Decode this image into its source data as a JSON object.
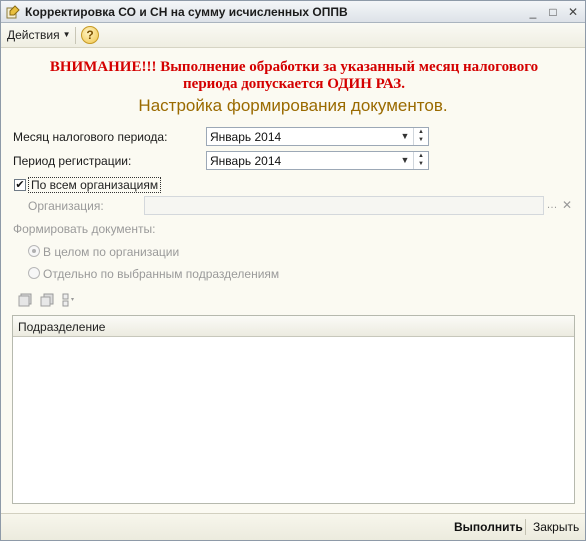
{
  "window": {
    "title": "Корректировка СО и СН на сумму исчисленных ОППВ",
    "icon": "processing-icon"
  },
  "menu": {
    "actions_label": "Действия",
    "help_label": "?"
  },
  "warning": {
    "line1": "ВНИМАНИЕ!!! Выполнение обработки за указанный месяц налогового",
    "line2": "периода допускается ОДИН РАЗ."
  },
  "heading": "Настройка формирования документов.",
  "form": {
    "tax_month_label": "Месяц налогового периода:",
    "tax_month_value": "Январь 2014",
    "reg_period_label": "Период регистрации:",
    "reg_period_value": "Январь 2014",
    "all_orgs_label": "По всем организациям",
    "all_orgs_checked": true,
    "org_label": "Организация:",
    "org_value": "",
    "create_docs_label": "Формировать документы:",
    "radio_whole_label": "В целом по организации",
    "radio_whole_selected": true,
    "radio_selected_label": "Отдельно по выбранным подразделениям"
  },
  "table": {
    "columns": [
      "Подразделение"
    ],
    "rows": []
  },
  "footer": {
    "run_label": "Выполнить",
    "close_label": "Закрыть"
  },
  "colors": {
    "warning": "#d40000",
    "heading": "#9a6a00",
    "background": "#fbfaf2"
  }
}
